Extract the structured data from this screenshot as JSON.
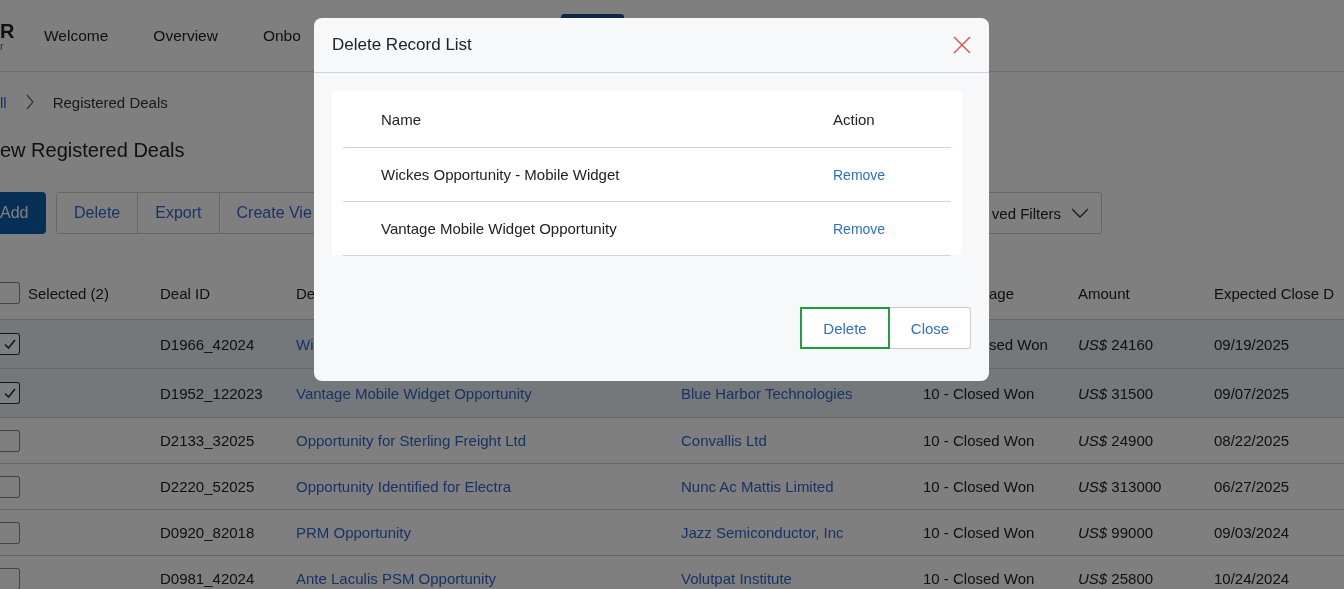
{
  "logo": {
    "mark": "R",
    "sub": "r"
  },
  "nav": [
    {
      "label": "Welcome"
    },
    {
      "label": "Overview"
    },
    {
      "label": "Onbo"
    }
  ],
  "breadcrumb": {
    "parent": "ll",
    "current": "Registered Deals"
  },
  "title": "ew Registered Deals",
  "toolbar": {
    "add": "Add",
    "actions": [
      "Delete",
      "Export",
      "Create Vie"
    ],
    "filters": "ved Filters"
  },
  "table": {
    "columns": [
      "Selected (2)",
      "Deal ID",
      "De",
      "",
      "age",
      "Amount",
      "Expected Close D"
    ],
    "header_checked": false,
    "rows": [
      {
        "checked": true,
        "deal_id": "D1966_42024",
        "deal_name": "Wi",
        "account": "",
        "stage": "sed Won",
        "amount": "*US$* 24160",
        "close_date": "09/19/2025"
      },
      {
        "checked": true,
        "deal_id": "D1952_122023",
        "deal_name": "Vantage Mobile Widget Opportunity",
        "account": "Blue Harbor Technologies",
        "stage": "10 - Closed Won",
        "amount": "*US$* 31500",
        "close_date": "09/07/2025"
      },
      {
        "checked": false,
        "deal_id": "D2133_32025",
        "deal_name": "Opportunity for Sterling Freight Ltd",
        "account": "Convallis Ltd",
        "stage": "10 - Closed Won",
        "amount": "*US$* 24900",
        "close_date": "08/22/2025"
      },
      {
        "checked": false,
        "deal_id": "D2220_52025",
        "deal_name": "Opportunity Identified for Electra",
        "account": "Nunc Ac Mattis Limited",
        "stage": "10 - Closed Won",
        "amount": "*US$* 313000",
        "close_date": "06/27/2025"
      },
      {
        "checked": false,
        "deal_id": "D0920_82018",
        "deal_name": "PRM Opportunity",
        "account": "Jazz Semiconductor, Inc",
        "stage": "10 - Closed Won",
        "amount": "*US$* 99000",
        "close_date": "09/03/2024"
      },
      {
        "checked": false,
        "deal_id": "D0981_42024",
        "deal_name": "Ante Laculis PSM Opportunity",
        "account": "Volutpat Institute",
        "stage": "10 - Closed Won",
        "amount": "*US$* 25800",
        "close_date": "10/24/2024"
      }
    ]
  },
  "dialog": {
    "title": "Delete Record List",
    "columns": [
      "Name",
      "Action"
    ],
    "rows": [
      {
        "name": "Wickes Opportunity - Mobile Widget",
        "action": "Remove"
      },
      {
        "name": "Vantage Mobile Widget Opportunity",
        "action": "Remove"
      }
    ],
    "buttons": [
      {
        "label": "Delete",
        "kind": "primary",
        "focused": true
      },
      {
        "label": "Close",
        "kind": "secondary",
        "focused": false
      }
    ]
  }
}
